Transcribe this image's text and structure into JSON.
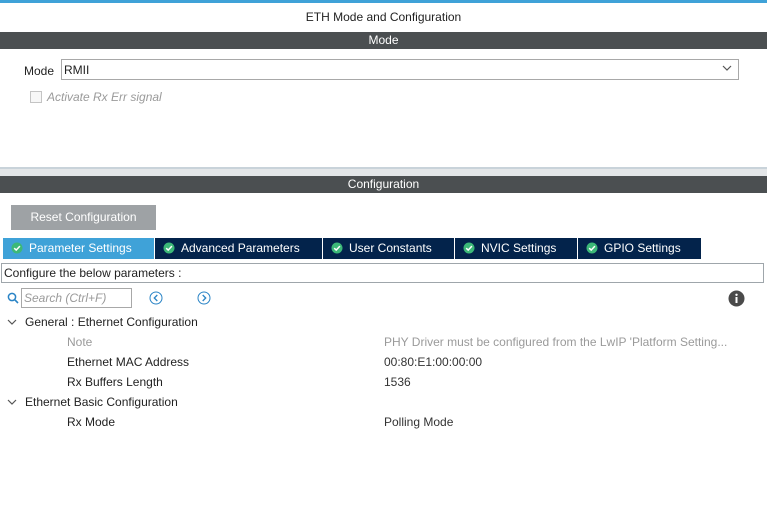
{
  "window": {
    "title": "ETH Mode and Configuration"
  },
  "mode_section": {
    "header": "Mode",
    "mode_label": "Mode",
    "mode_value": "RMII",
    "checkbox_label": "Activate Rx Err signal"
  },
  "config_section": {
    "header": "Configuration",
    "reset_button": "Reset Configuration",
    "tabs": [
      {
        "label": "Parameter Settings",
        "active": true
      },
      {
        "label": "Advanced Parameters",
        "active": false
      },
      {
        "label": "User Constants",
        "active": false
      },
      {
        "label": "NVIC Settings",
        "active": false
      },
      {
        "label": "GPIO Settings",
        "active": false
      }
    ],
    "description": "Configure the below parameters :",
    "search_placeholder": "Search (Ctrl+F)",
    "tree": {
      "group1": {
        "label": "General : Ethernet Configuration",
        "rows": [
          {
            "name": "Note",
            "value": "PHY Driver must be configured from the LwIP 'Platform Setting..."
          },
          {
            "name": "Ethernet MAC Address",
            "value": "00:80:E1:00:00:00"
          },
          {
            "name": "Rx Buffers Length",
            "value": "1536"
          }
        ]
      },
      "group2": {
        "label": "Ethernet Basic Configuration",
        "rows": [
          {
            "name": "Rx Mode",
            "value": "Polling Mode"
          }
        ]
      }
    }
  },
  "colors": {
    "accent": "#3fa2d8",
    "tab_dark": "#03234b",
    "section_bar": "#4b4f51",
    "button_gray": "#9ea2a5",
    "tick_green": "#3cb878"
  }
}
